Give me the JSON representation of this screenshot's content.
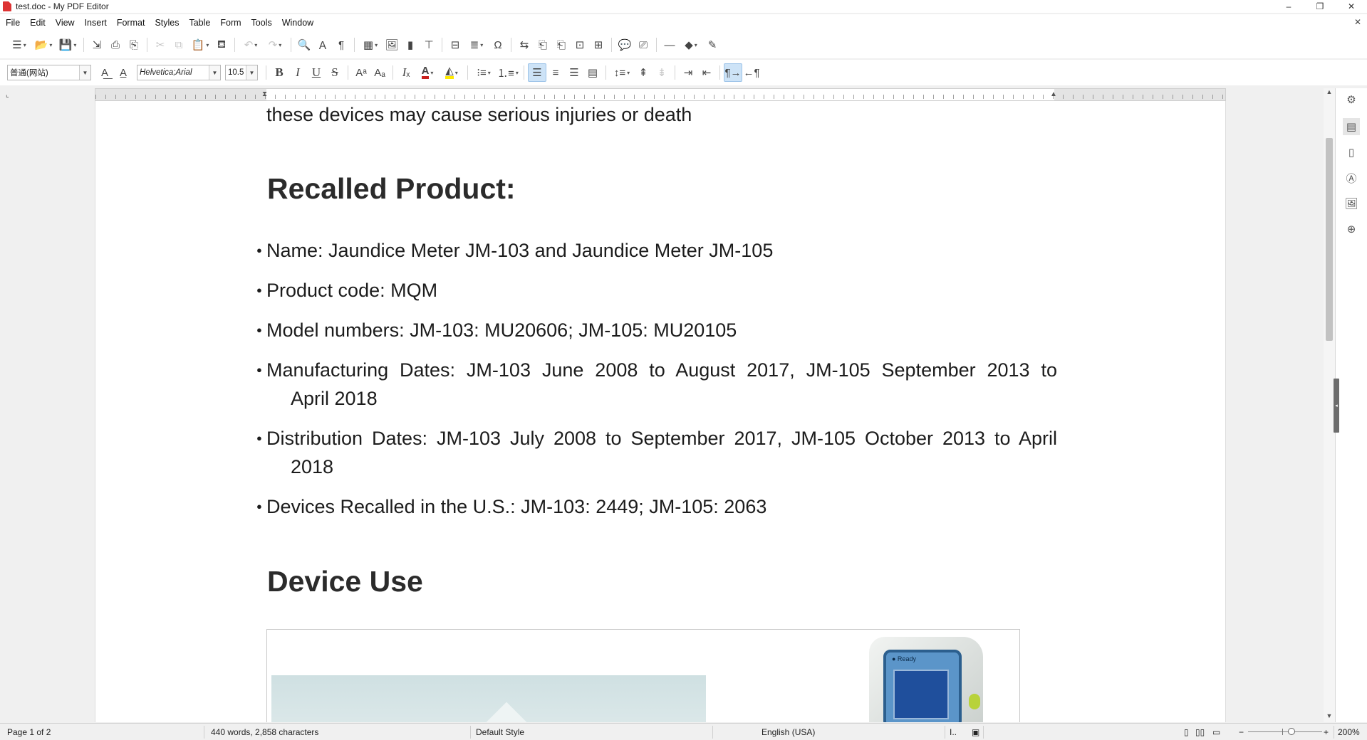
{
  "window": {
    "title": "test.doc - My PDF Editor",
    "controls": {
      "minimize": "–",
      "restore": "❐",
      "close": "✕"
    },
    "doc_close": "✕"
  },
  "menu": [
    "File",
    "Edit",
    "View",
    "Insert",
    "Format",
    "Styles",
    "Table",
    "Form",
    "Tools",
    "Window"
  ],
  "format_bar": {
    "paragraph_style": "普通(网站)",
    "font_name": "Helvetica;Arial",
    "font_size": "10.5"
  },
  "colors": {
    "font_color": "#c9211e",
    "highlight_color": "#ffea00",
    "active_button": "#cde3f7"
  },
  "document": {
    "lead_text": "these devices may cause serious injuries or death",
    "heading_recalled": "Recalled Product:",
    "items": [
      {
        "text": "Name: Jaundice Meter JM-103 and Jaundice Meter JM-105"
      },
      {
        "text": "Product code: MQM"
      },
      {
        "text": "Model numbers: JM-103: MU20606; JM-105: MU20105"
      },
      {
        "line1": "Manufacturing Dates: JM-103 June 2008 to August 2017, JM-105 September 2013 to",
        "line2": "April 2018"
      },
      {
        "line1": "Distribution Dates: JM-103 July 2008 to September 2017, JM-105 October 2013 to April",
        "line2": "2018"
      },
      {
        "text": "Devices Recalled in the U.S.: JM-103: 2449; JM-105: 2063"
      }
    ],
    "heading_device": "Device Use",
    "figure_label": "● Ready"
  },
  "status": {
    "page": "Page 1 of 2",
    "words": "440 words, 2,858 characters",
    "style": "Default Style",
    "language": "English (USA)",
    "zoom": "200%"
  }
}
